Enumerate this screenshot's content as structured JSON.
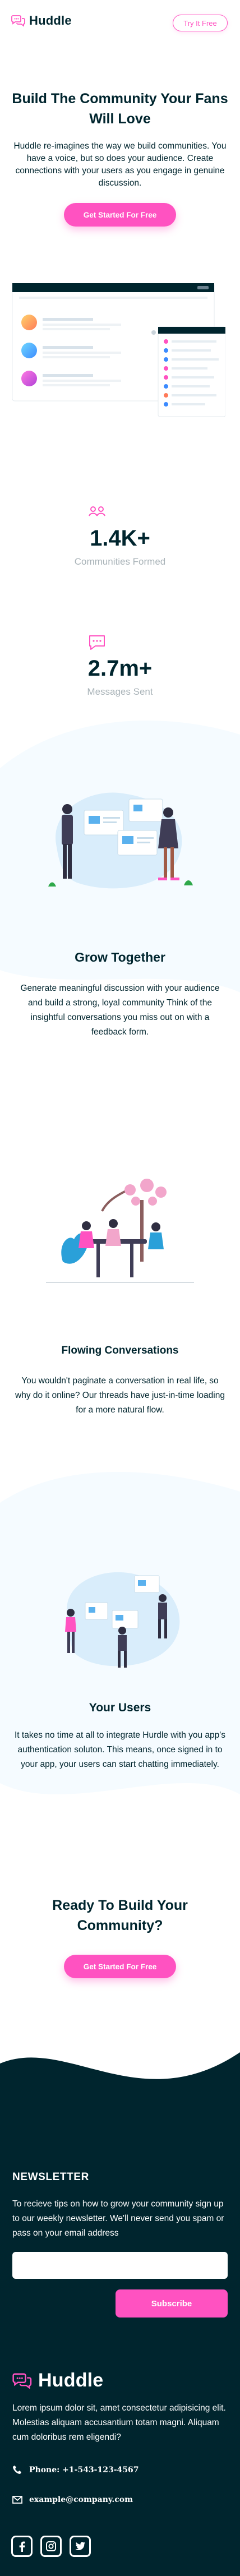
{
  "header": {
    "logo_text": "Huddle",
    "try_label": "Try It Free"
  },
  "hero": {
    "title": "Build The Community Your Fans Will Love",
    "description": "Huddle re-imagines the way we build communities. You have a voice, but so does your audience. Create connections with your users as you engage in genuine discussion.",
    "cta_label": "Get Started For Free"
  },
  "stats": [
    {
      "value": "1.4K+",
      "label": "Communities Formed",
      "icon": "communities-icon"
    },
    {
      "value": "2.7m+",
      "label": "Messages Sent",
      "icon": "messages-icon"
    }
  ],
  "features": [
    {
      "title": "Grow Together",
      "description": "Generate meaningful discussion with your audience and build a strong, loyal community Think of the insightful conversations you miss out on with a feedback form."
    },
    {
      "title": "Flowing Conversations",
      "description": "You wouldn't paginate a conversation in real life, so why do it online? Our threads have just-in-time loading for a more natural flow."
    },
    {
      "title": "Your Users",
      "description": "It takes no time at all to integrate Hurdle with you app's authentication soluton. This means, once signed in to your app, your users can start chatting immediately."
    }
  ],
  "cta": {
    "title": "Ready To Build Your Community?",
    "button_label": "Get Started For Free"
  },
  "newsletter": {
    "title": "NEWSLETTER",
    "description": "To recieve tips on how to grow your community sign up to our weekly newsletter. We'll never send you spam or pass on your email address",
    "email_value": "",
    "subscribe_label": "Subscribe"
  },
  "footer": {
    "logo_text": "Huddle",
    "about": "Lorem ipsum dolor sit, amet consectetur adipisicing elit. Molestias aliquam accusantium totam magni. Aliquam cum doloribus rem eligendi?",
    "phone": "Phone: +1-543-123-4567",
    "email": "example@company.com",
    "socials": [
      "facebook-icon",
      "instagram-icon",
      "twitter-icon"
    ]
  },
  "colors": {
    "pink": "#ff52c1",
    "dark": "#00252e",
    "light_bg": "#f5fbff",
    "muted": "#a9b3b8"
  }
}
